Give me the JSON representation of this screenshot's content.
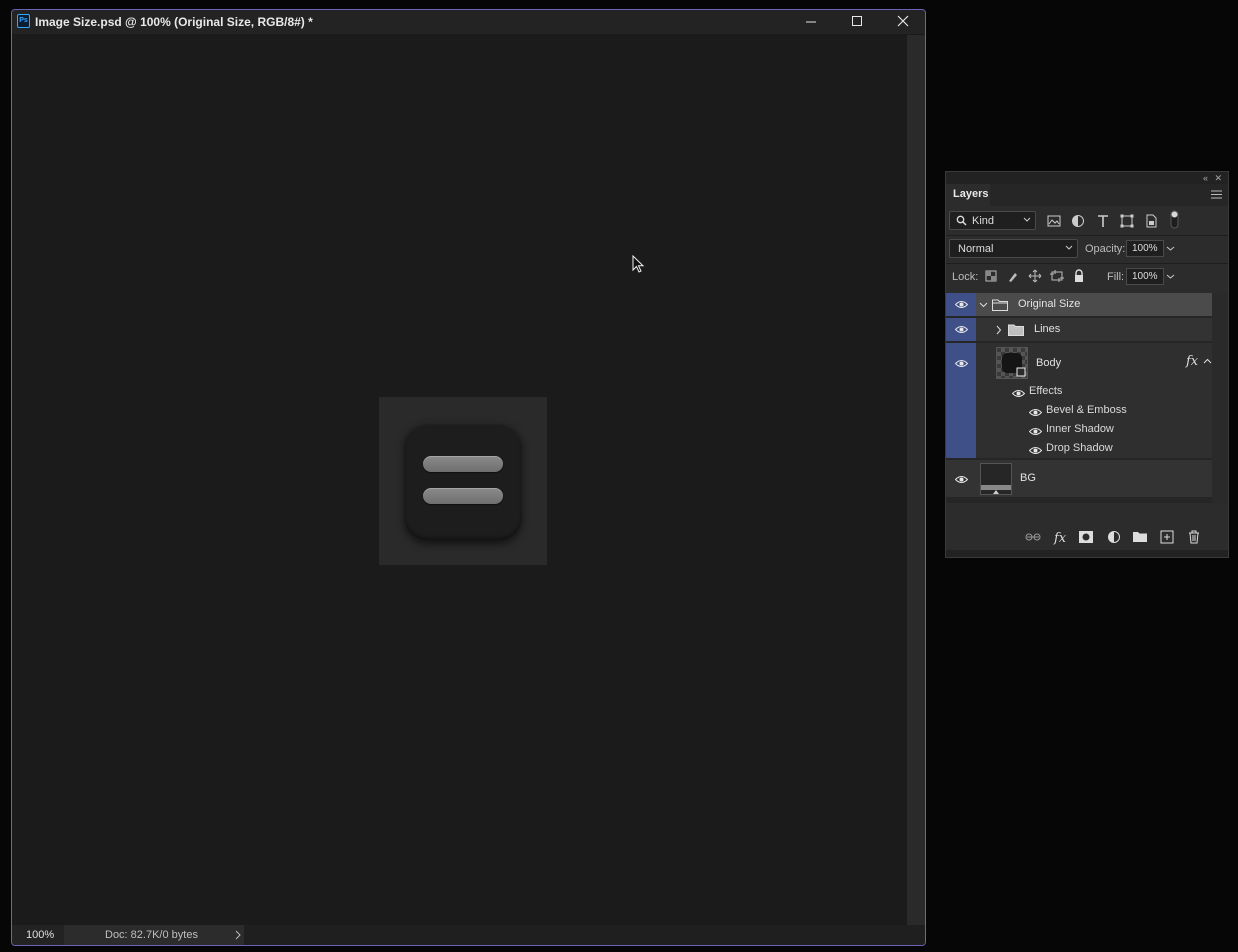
{
  "document": {
    "app_badge": "Ps",
    "title": "Image Size.psd @ 100% (Original Size, RGB/8#) *",
    "zoom": "100%",
    "doc_info": "Doc: 82.7K/0 bytes"
  },
  "layers_panel": {
    "tab_label": "Layers",
    "filter_kind": "Kind",
    "blend_mode": "Normal",
    "opacity_label": "Opacity:",
    "opacity_value": "100%",
    "lock_label": "Lock:",
    "fill_label": "Fill:",
    "fill_value": "100%",
    "layers": [
      {
        "name": "Original Size",
        "type": "group",
        "expanded": true,
        "selected": true
      },
      {
        "name": "Lines",
        "type": "group",
        "expanded": false
      },
      {
        "name": "Body",
        "type": "shape",
        "has_fx": true
      },
      {
        "name": "BG",
        "type": "pixel"
      }
    ],
    "effects_label": "Effects",
    "effects": [
      "Bevel & Emboss",
      "Inner Shadow",
      "Drop Shadow"
    ],
    "fx_badge": "fx"
  },
  "colors": {
    "window_accent": "#6b64b4",
    "visibility_column": "#3f4f88",
    "canvas_bg": "#1b1b1b",
    "ps_blue": "#31a8ff"
  }
}
